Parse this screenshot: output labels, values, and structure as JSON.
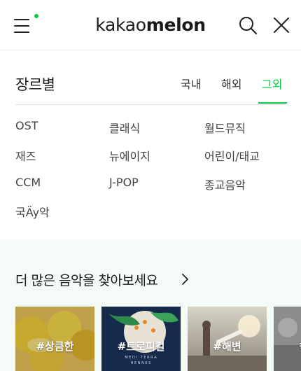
{
  "header": {
    "logo_light": "kakao",
    "logo_bold": "melon",
    "icons": [
      "menu-icon",
      "search-icon",
      "close-icon"
    ],
    "notification_dot_color": "#00cd3c"
  },
  "genre": {
    "title": "장르별",
    "tabs": [
      {
        "label": "국내",
        "active": false
      },
      {
        "label": "해외",
        "active": false
      },
      {
        "label": "그외",
        "active": true
      }
    ],
    "accent_color": "#00cd3c",
    "items": [
      "OST",
      "클래식",
      "월드뮤직",
      "재즈",
      "뉴에이지",
      "어린이/태교",
      "CCM",
      "J-POP",
      "종교음악",
      "국Äy악"
    ]
  },
  "more": {
    "label": "더 많은 음악을 찾아보세요",
    "cards": [
      {
        "tag": "#상큼한"
      },
      {
        "tag": "#트로피컬"
      },
      {
        "tag": "#해변"
      },
      {
        "tag": "#"
      }
    ]
  }
}
